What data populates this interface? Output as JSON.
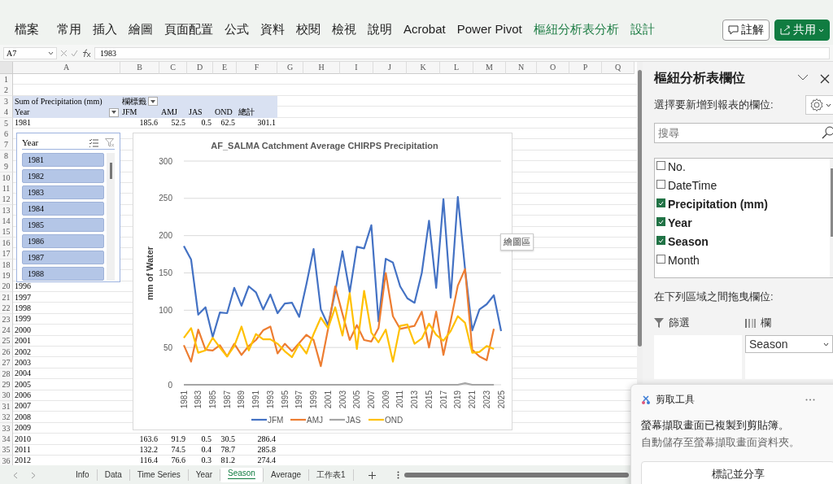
{
  "ribbon": {
    "tabs": [
      {
        "label": "檔案",
        "kind": "normal"
      },
      {
        "label": "常用",
        "kind": "normal"
      },
      {
        "label": "插入",
        "kind": "normal"
      },
      {
        "label": "繪圖",
        "kind": "normal"
      },
      {
        "label": "頁面配置",
        "kind": "normal"
      },
      {
        "label": "公式",
        "kind": "normal"
      },
      {
        "label": "資料",
        "kind": "normal"
      },
      {
        "label": "校閱",
        "kind": "normal"
      },
      {
        "label": "檢視",
        "kind": "normal"
      },
      {
        "label": "說明",
        "kind": "normal"
      },
      {
        "label": "Acrobat",
        "kind": "normal"
      },
      {
        "label": "Power Pivot",
        "kind": "normal"
      },
      {
        "label": "樞紐分析表分析",
        "kind": "contextual"
      },
      {
        "label": "設計",
        "kind": "contextual"
      }
    ],
    "comment_button": "註解",
    "share_button": "共用"
  },
  "formula_bar": {
    "name_box": "A7",
    "formula": "1983"
  },
  "sheet": {
    "columns": [
      "A",
      "B",
      "C",
      "D",
      "E",
      "F",
      "G",
      "H",
      "I",
      "J",
      "K",
      "L",
      "M",
      "N",
      "O",
      "P",
      "Q"
    ],
    "rows": [
      {
        "number": "1",
        "kind": "data"
      },
      {
        "number": "2",
        "kind": "data"
      },
      {
        "number": "3",
        "kind": "pivot_header",
        "cells": [
          {
            "text": "Sum of Precipitation (mm)"
          },
          {
            "text": "欄標籤",
            "filter_button": true
          }
        ]
      },
      {
        "number": "4",
        "kind": "pivot_header",
        "cells": [
          {
            "text": "Year",
            "filter_button": true
          },
          {
            "text": "JFM"
          },
          {
            "text": "AMJ"
          },
          {
            "text": "JAS"
          },
          {
            "text": "OND"
          },
          {
            "text": "總計"
          }
        ]
      },
      {
        "number": "5",
        "kind": "data",
        "cells": [
          {
            "text": "1981"
          },
          {
            "text": "185.6"
          },
          {
            "text": "52.5"
          },
          {
            "text": "0.5"
          },
          {
            "text": "62.5"
          },
          {
            "text": "301.1"
          }
        ]
      },
      {
        "number": "6",
        "kind": "data"
      },
      {
        "number": "7",
        "kind": "data"
      },
      {
        "number": "8",
        "kind": "data"
      },
      {
        "number": "9",
        "kind": "data"
      },
      {
        "number": "10",
        "kind": "data"
      },
      {
        "number": "11",
        "kind": "data"
      },
      {
        "number": "12",
        "kind": "data"
      },
      {
        "number": "13",
        "kind": "data"
      },
      {
        "number": "14",
        "kind": "data"
      },
      {
        "number": "15",
        "kind": "data"
      },
      {
        "number": "16",
        "kind": "data"
      },
      {
        "number": "17",
        "kind": "data"
      },
      {
        "number": "18",
        "kind": "data"
      },
      {
        "number": "19",
        "kind": "data"
      },
      {
        "number": "20",
        "kind": "data",
        "cells": [
          {
            "text": "1996"
          }
        ]
      },
      {
        "number": "21",
        "kind": "data",
        "cells": [
          {
            "text": "1997"
          }
        ]
      },
      {
        "number": "22",
        "kind": "data",
        "cells": [
          {
            "text": "1998"
          }
        ]
      },
      {
        "number": "23",
        "kind": "data",
        "cells": [
          {
            "text": "1999"
          }
        ]
      },
      {
        "number": "24",
        "kind": "data",
        "cells": [
          {
            "text": "2000"
          }
        ]
      },
      {
        "number": "25",
        "kind": "data",
        "cells": [
          {
            "text": "2001"
          }
        ]
      },
      {
        "number": "26",
        "kind": "data",
        "cells": [
          {
            "text": "2002"
          }
        ]
      },
      {
        "number": "27",
        "kind": "data",
        "cells": [
          {
            "text": "2003"
          }
        ]
      },
      {
        "number": "28",
        "kind": "data",
        "cells": [
          {
            "text": "2004"
          }
        ]
      },
      {
        "number": "29",
        "kind": "data",
        "cells": [
          {
            "text": "2005"
          }
        ]
      },
      {
        "number": "30",
        "kind": "data",
        "cells": [
          {
            "text": "2006"
          }
        ]
      },
      {
        "number": "31",
        "kind": "data",
        "cells": [
          {
            "text": "2007"
          }
        ]
      },
      {
        "number": "32",
        "kind": "data",
        "cells": [
          {
            "text": "2008"
          }
        ]
      },
      {
        "number": "33",
        "kind": "data",
        "cells": [
          {
            "text": "2009"
          }
        ]
      },
      {
        "number": "34",
        "kind": "data",
        "cells": [
          {
            "text": "2010"
          },
          {
            "text": "163.6"
          },
          {
            "text": "91.9"
          },
          {
            "text": "0.5"
          },
          {
            "text": "30.5"
          },
          {
            "text": "286.4"
          }
        ]
      },
      {
        "number": "35",
        "kind": "data",
        "cells": [
          {
            "text": "2011"
          },
          {
            "text": "132.2"
          },
          {
            "text": "74.5"
          },
          {
            "text": "0.4"
          },
          {
            "text": "78.7"
          },
          {
            "text": "285.8"
          }
        ]
      },
      {
        "number": "36",
        "kind": "data",
        "cells": [
          {
            "text": "2012"
          },
          {
            "text": "116.4"
          },
          {
            "text": "76.6"
          },
          {
            "text": "0.3"
          },
          {
            "text": "81.2"
          },
          {
            "text": "274.4"
          }
        ]
      }
    ]
  },
  "slicer": {
    "title": "Year",
    "items": [
      {
        "label": "1981",
        "selected": true
      },
      {
        "label": "1982",
        "selected": true
      },
      {
        "label": "1983",
        "selected": true
      },
      {
        "label": "1984",
        "selected": true
      },
      {
        "label": "1985",
        "selected": true
      },
      {
        "label": "1986",
        "selected": true
      },
      {
        "label": "1987",
        "selected": true
      },
      {
        "label": "1988",
        "selected": true
      }
    ]
  },
  "chart": {
    "tooltip": "繪圖區",
    "chart_data": {
      "type": "line",
      "title": "AF_SALMA Catchment Average CHIRPS Precipitation",
      "ylabel": "mm of Water",
      "x": [
        1981,
        1982,
        1983,
        1984,
        1985,
        1986,
        1987,
        1988,
        1989,
        1990,
        1991,
        1992,
        1993,
        1994,
        1995,
        1996,
        1997,
        1998,
        1999,
        2000,
        2001,
        2002,
        2003,
        2004,
        2005,
        2006,
        2007,
        2008,
        2009,
        2010,
        2011,
        2012,
        2013,
        2014,
        2015,
        2016,
        2017,
        2018,
        2019,
        2020,
        2021,
        2022,
        2023,
        2024,
        2025
      ],
      "xlim": [
        1981,
        2025
      ],
      "xticks": [
        {
          "value": 1981,
          "label": "1981"
        },
        {
          "value": 1983,
          "label": "1983"
        },
        {
          "value": 1985,
          "label": "1985"
        },
        {
          "value": 1987,
          "label": "1987"
        },
        {
          "value": 1989,
          "label": "1989"
        },
        {
          "value": 1991,
          "label": "1991"
        },
        {
          "value": 1993,
          "label": "1993"
        },
        {
          "value": 1995,
          "label": "1995"
        },
        {
          "value": 1997,
          "label": "1997"
        },
        {
          "value": 1999,
          "label": "1999"
        },
        {
          "value": 2001,
          "label": "2001"
        },
        {
          "value": 2003,
          "label": "2003"
        },
        {
          "value": 2005,
          "label": "2005"
        },
        {
          "value": 2007,
          "label": "2007"
        },
        {
          "value": 2009,
          "label": "2009"
        },
        {
          "value": 2011,
          "label": "2011"
        },
        {
          "value": 2013,
          "label": "2013"
        },
        {
          "value": 2015,
          "label": "2015"
        },
        {
          "value": 2017,
          "label": "2017"
        },
        {
          "value": 2019,
          "label": "2019"
        },
        {
          "value": 2021,
          "label": "2021"
        },
        {
          "value": 2023,
          "label": "2023"
        },
        {
          "value": 2025,
          "label": "2025"
        }
      ],
      "ylim": [
        0,
        300
      ],
      "yticks": [
        0,
        50,
        100,
        150,
        200,
        250,
        300
      ],
      "grid": true,
      "legend": true,
      "series": [
        {
          "name": "JFM",
          "color": "#4472c4",
          "values": [
            186,
            168,
            94,
            104,
            64,
            97,
            96,
            130,
            106,
            132,
            124,
            101,
            121,
            96,
            109,
            110,
            91,
            135,
            182,
            101,
            80,
            125,
            179,
            124,
            185,
            183,
            214,
            85,
            169,
            164,
            132,
            116,
            110,
            150,
            220,
            130,
            249,
            117,
            252,
            155,
            73,
            101,
            108,
            120,
            72
          ]
        },
        {
          "name": "AMJ",
          "color": "#ed7d31",
          "values": [
            53,
            31,
            74,
            47,
            46,
            53,
            38,
            55,
            40,
            52,
            60,
            73,
            78,
            42,
            55,
            45,
            56,
            67,
            60,
            25,
            75,
            132,
            95,
            60,
            80,
            60,
            58,
            76,
            150,
            92,
            75,
            77,
            79,
            98,
            50,
            98,
            40,
            85,
            133,
            155,
            47,
            38,
            33,
            75,
            null
          ]
        },
        {
          "name": "JAS",
          "color": "#a5a5a5",
          "values": [
            0,
            0,
            0,
            0,
            0,
            0,
            0,
            0,
            0,
            0,
            0,
            0,
            0,
            0,
            0,
            0,
            0,
            0,
            0,
            0,
            0,
            0,
            0,
            0,
            0,
            0,
            0,
            0,
            0,
            0,
            0,
            0,
            0,
            0,
            0,
            0,
            0,
            0,
            0,
            2,
            0,
            0,
            0,
            0,
            null
          ]
        },
        {
          "name": "OND",
          "color": "#ffc000",
          "values": [
            63,
            76,
            43,
            46,
            63,
            50,
            38,
            52,
            78,
            46,
            68,
            61,
            61,
            55,
            45,
            37,
            55,
            42,
            68,
            90,
            76,
            104,
            66,
            123,
            48,
            126,
            70,
            57,
            74,
            31,
            79,
            81,
            55,
            62,
            82,
            67,
            59,
            72,
            92,
            83,
            43,
            44,
            52,
            48,
            null
          ]
        }
      ]
    }
  },
  "field_pane": {
    "title": "樞紐分析表欄位",
    "subtitle": "選擇要新增到報表的欄位:",
    "search_placeholder": "搜尋",
    "fields": [
      {
        "label": "No.",
        "checked": false
      },
      {
        "label": "DateTime",
        "checked": false
      },
      {
        "label": "Precipitation (mm)",
        "checked": true
      },
      {
        "label": "Year",
        "checked": true
      },
      {
        "label": "Season",
        "checked": true
      },
      {
        "label": "Month",
        "checked": false
      }
    ],
    "drag_label": "在下列區域之間拖曳欄位:",
    "areas": [
      {
        "kind": "filters",
        "label": "篩選"
      },
      {
        "kind": "columns",
        "label": "欄",
        "items": [
          "Season"
        ]
      }
    ]
  },
  "sheet_tabs": [
    {
      "label": "Info",
      "selected": false
    },
    {
      "label": "Data",
      "selected": false
    },
    {
      "label": "Time Series",
      "selected": false
    },
    {
      "label": "Year",
      "selected": false
    },
    {
      "label": "Season",
      "selected": true
    },
    {
      "label": "Average",
      "selected": false
    },
    {
      "label": "工作表1",
      "selected": false
    }
  ],
  "notification": {
    "app": "剪取工具",
    "message": "螢幕擷取畫面已複製到剪貼簿。",
    "detail": "自動儲存至螢幕擷取畫面資料夾。",
    "action": "標記並分享"
  }
}
